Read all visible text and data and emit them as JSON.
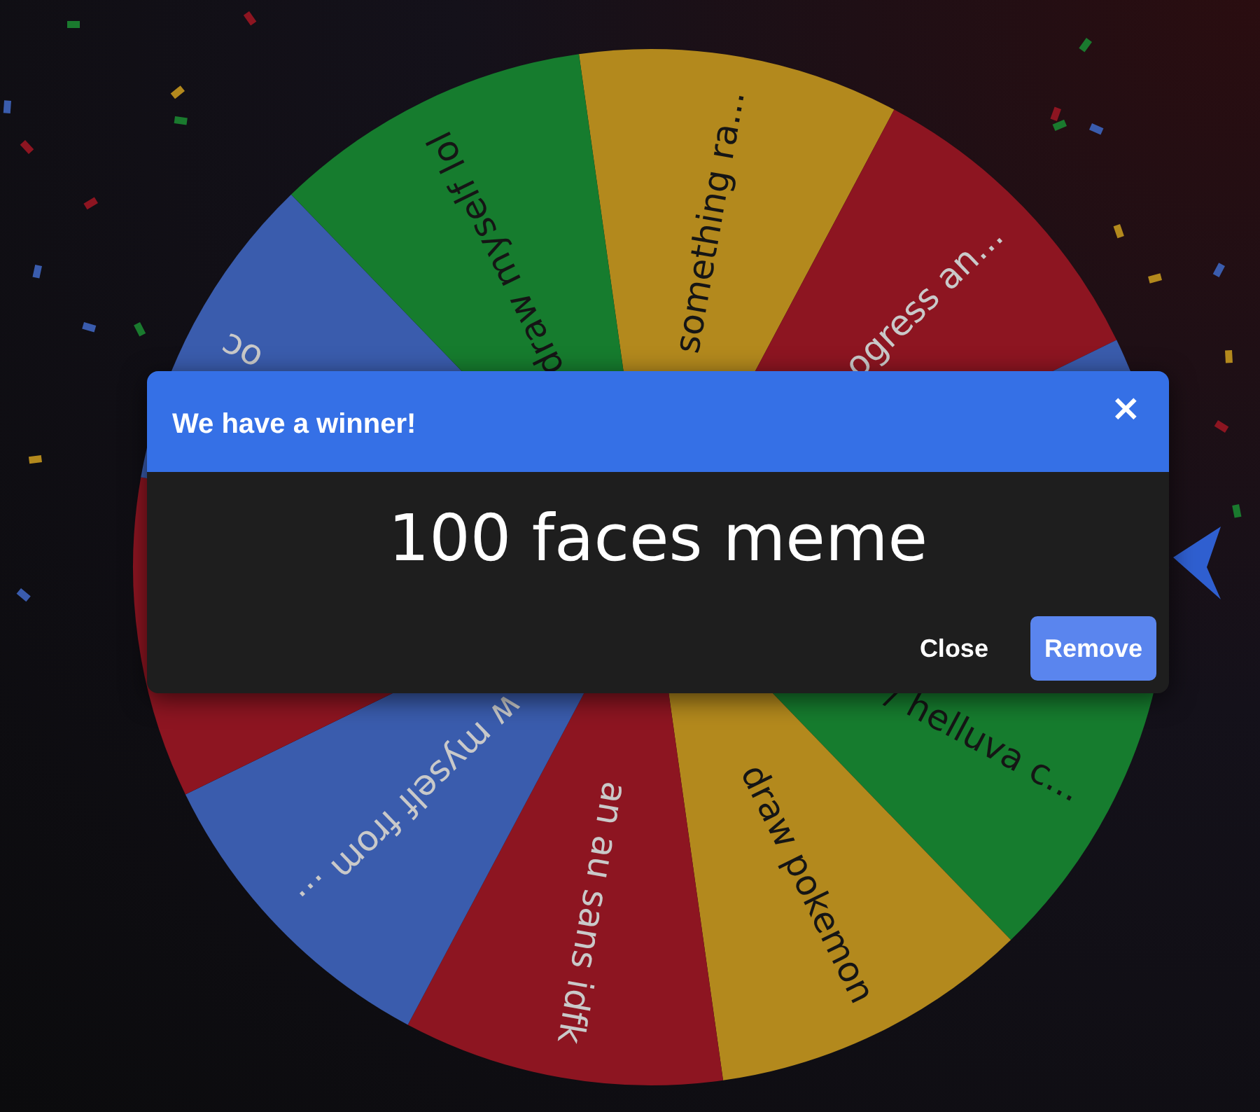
{
  "wheel": {
    "segments": [
      {
        "color": "#b3891d",
        "label": "something ra..."
      },
      {
        "color": "#8d1521",
        "label": "ogress an..."
      },
      {
        "color": "#3a5cad"
      },
      {
        "color": "#167c2e",
        "label": "/ helluva c..."
      },
      {
        "color": "#b3891d",
        "label": "draw pokemon"
      },
      {
        "color": "#8d1521",
        "label": "an au sans idfk"
      },
      {
        "color": "#3a5cad",
        "label": "w myself from ..."
      },
      {
        "color": "#8d1521"
      },
      {
        "color": "#3a5cad",
        "label": "oc"
      },
      {
        "color": "#167c2e",
        "label": "draw myself lol"
      }
    ]
  },
  "dialog": {
    "title": "We have a winner!",
    "close_icon": "×",
    "winner": "100 faces meme",
    "buttons": [
      {
        "label": "Close",
        "kind": "text"
      },
      {
        "label": "Remove",
        "kind": "primary"
      }
    ]
  }
}
